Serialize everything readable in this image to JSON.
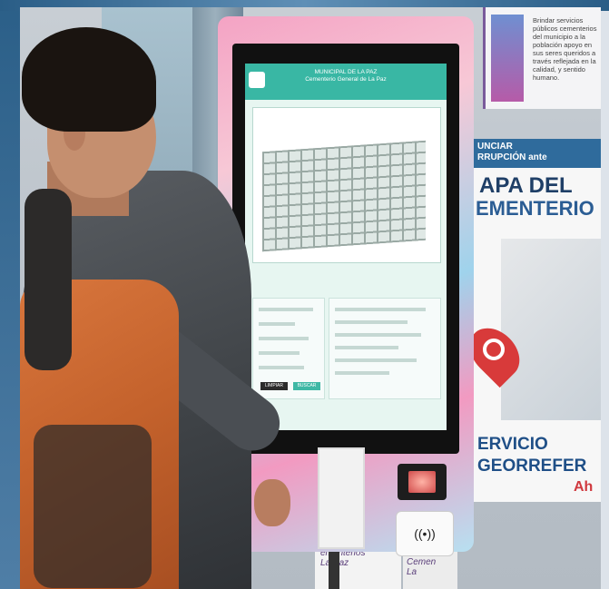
{
  "photo": {
    "kiosk": {
      "screen_header_line1": "MUNICIPAL DE LA PAZ",
      "screen_header_line2": "Cementerio General de La Paz",
      "button_clear": "LIMPIAR",
      "button_search": "BUSCAR",
      "contactless_symbol": "((•))"
    },
    "poster_top": {
      "text": "Brindar servicios públicos cementerios del municipio a la población apoyo en sus seres queridos a través reflejada en la calidad, y sentido humano."
    },
    "poster_main": {
      "band_line1": "UNCIAR",
      "band_line2": "RRUPCIÓN ante",
      "title1": "APA DEL",
      "title2": "EMENTERIO",
      "footer1": "ERVICIO",
      "footer2": "GEORREFER",
      "footer3": "Ah"
    },
    "sign_bottom_left": "ementerios\nLa Paz",
    "sign_bottom_right": "Cemen\nLa"
  }
}
